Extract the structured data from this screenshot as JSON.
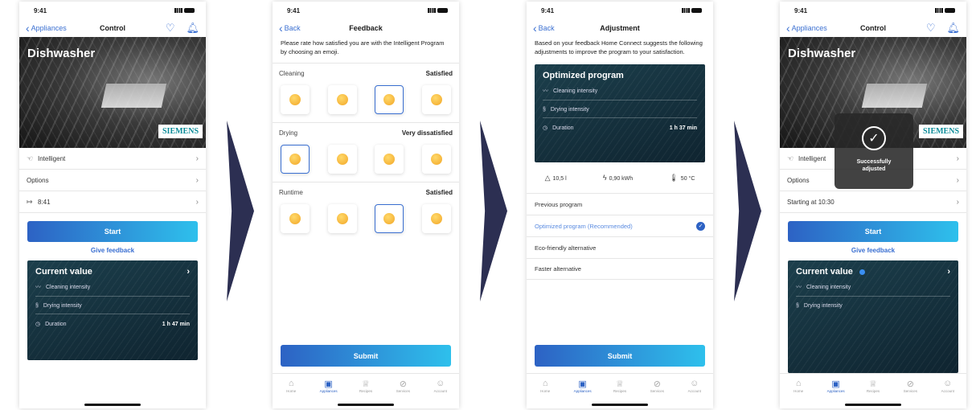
{
  "status": {
    "time": "9:41"
  },
  "screen1": {
    "nav": {
      "back": "Appliances",
      "title": "Control"
    },
    "hero": {
      "title": "Dishwasher",
      "brand": "SIEMENS"
    },
    "rows": [
      {
        "label": "Intelligent"
      },
      {
        "label": "Options"
      },
      {
        "label": "8:41"
      }
    ],
    "start": "Start",
    "feedback": "Give feedback",
    "current": {
      "title": "Current value",
      "items": [
        {
          "label": "Cleaning intensity",
          "value": ""
        },
        {
          "label": "Drying intensity",
          "value": ""
        },
        {
          "label": "Duration",
          "value": "1 h 47 min"
        }
      ]
    }
  },
  "screen2": {
    "nav": {
      "back": "Back",
      "title": "Feedback"
    },
    "intro": "Please rate how satisfied you are with the Intelligent Program by choosing an emoji.",
    "sections": [
      {
        "label": "Cleaning",
        "value": "Satisfied",
        "selected": 2
      },
      {
        "label": "Drying",
        "value": "Very dissatisfied",
        "selected": 0
      },
      {
        "label": "Runtime",
        "value": "Satisfied",
        "selected": 2
      }
    ],
    "submit": "Submit"
  },
  "screen3": {
    "nav": {
      "back": "Back",
      "title": "Adjustment"
    },
    "intro": "Based on your feedback Home Connect suggests the following adjustments to improve the program to your satisfaction.",
    "card": {
      "title": "Optimized program",
      "items": [
        {
          "label": "Cleaning intensity",
          "value": ""
        },
        {
          "label": "Drying intensity",
          "value": ""
        },
        {
          "label": "Duration",
          "value": "1 h 37 min"
        }
      ]
    },
    "stats": {
      "water": "10,5 l",
      "energy": "0,90 kWh",
      "temp": "50 °C"
    },
    "choices": [
      "Previous program",
      "Optimized program (Recommended)",
      "Eco-friendly alternative",
      "Faster alternative"
    ],
    "submit": "Submit"
  },
  "screen4": {
    "nav": {
      "back": "Appliances",
      "title": "Control"
    },
    "hero": {
      "title": "Dishwasher",
      "brand": "SIEMENS"
    },
    "rows": [
      {
        "label": "Intelligent"
      },
      {
        "label": "Options"
      },
      {
        "label": "Starting at 10:30"
      }
    ],
    "start": "Start",
    "feedback": "Give feedback",
    "toast": "Successfully adjusted",
    "current": {
      "title": "Current value",
      "items": [
        {
          "label": "Cleaning intensity"
        },
        {
          "label": "Drying intensity"
        }
      ]
    }
  },
  "tabs": [
    "Home",
    "Appliances",
    "Recipes",
    "Services",
    "Account"
  ]
}
